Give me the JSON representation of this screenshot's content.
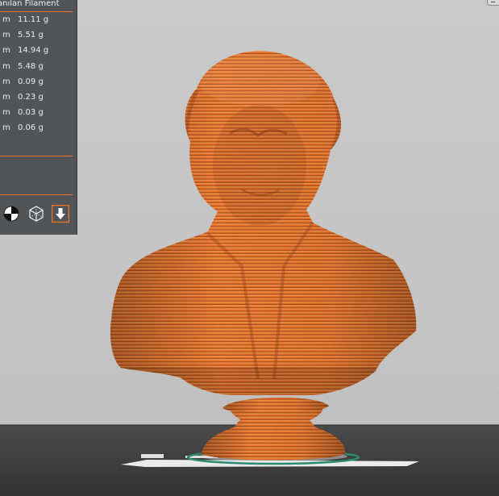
{
  "panel": {
    "header": "anılan Filament",
    "rows": [
      {
        "unit": "m",
        "value": "11.11 g"
      },
      {
        "unit": "m",
        "value": "5.51 g"
      },
      {
        "unit": "m",
        "value": "14.94 g"
      },
      {
        "unit": "m",
        "value": "5.48 g"
      },
      {
        "unit": "m",
        "value": "0.09 g"
      },
      {
        "unit": "m",
        "value": "0.23 g"
      },
      {
        "unit": "m",
        "value": "0.03 g"
      },
      {
        "unit": "m",
        "value": "0.06 g"
      }
    ],
    "view_buttons": [
      "section-view-icon",
      "wireframe-cube-icon",
      "layer-down-arrow-icon"
    ]
  },
  "colors": {
    "accent": "#ee7422",
    "panel_bg": "#535457",
    "model": "#e46f2a",
    "bed": "#3c3c3c",
    "background": "#c6c6c6"
  }
}
